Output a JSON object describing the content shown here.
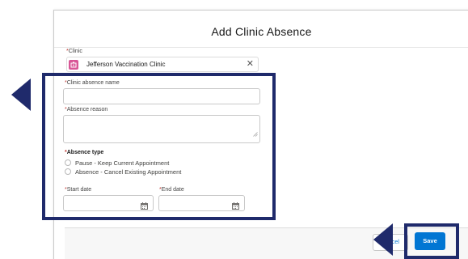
{
  "modal": {
    "title": "Add Clinic Absence",
    "save_label": "Save",
    "cancel_label": "Cancel"
  },
  "fields": {
    "clinic": {
      "label": "Clinic",
      "value": "Jefferson Vaccination Clinic",
      "icon": "clinic-icon",
      "clear_icon": "close-icon"
    },
    "absence_name": {
      "label": "Clinic absence name",
      "value": ""
    },
    "absence_reason": {
      "label": "Absence reason",
      "value": ""
    },
    "absence_type": {
      "label": "Absence type",
      "options": [
        "Pause - Keep Current Appointment",
        "Absence - Cancel Existing Appointment"
      ],
      "selected": null
    },
    "start_date": {
      "label": "Start date",
      "value": "",
      "icon": "calendar-icon"
    },
    "end_date": {
      "label": "End date",
      "value": "",
      "icon": "calendar-icon"
    }
  },
  "required_marker": "*",
  "colors": {
    "annotation": "#1f2a6b",
    "brand_button": "#0176d3",
    "clinic_icon": "#d85696",
    "required": "#c23934"
  }
}
